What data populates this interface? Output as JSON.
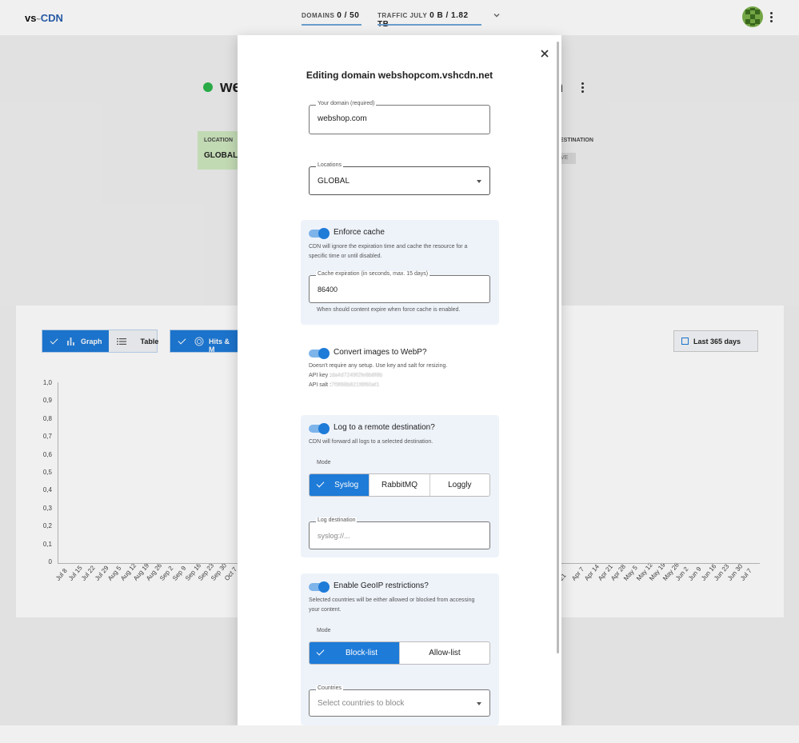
{
  "header": {
    "logo_prefix": "vs",
    "logo_sep": "~",
    "logo_suffix": "CDN",
    "domains_label": "DOMAINS",
    "domains_value": "0 / 50",
    "traffic_label": "TRAFFIC JULY",
    "traffic_value": "0 B / 1.82 TB"
  },
  "page": {
    "title_partial_left": "we",
    "title_partial_right": "n",
    "location_label": "LOCATION",
    "location_value": "GLOBAL",
    "destination_label": "ESTINATION",
    "destination_chip": "VE"
  },
  "chart_toolbar": {
    "graph_label": "Graph",
    "table_label": "Table",
    "metric_label": "Hits & M",
    "range_label": "Last 365 days"
  },
  "chart_data": {
    "type": "line",
    "y_ticks": [
      "1,0",
      "0,9",
      "0,8",
      "0,7",
      "0,6",
      "0,5",
      "0,4",
      "0,3",
      "0,2",
      "0,1",
      "0"
    ],
    "x_ticks_left": [
      "Jul 8",
      "Jul 15",
      "Jul 22",
      "Jul 29",
      "Aug 5",
      "Aug 12",
      "Aug 19",
      "Aug 26",
      "Sep 2",
      "Sep 9",
      "Sep 16",
      "Sep 23",
      "Sep 30",
      "Oct 7"
    ],
    "x_ticks_right": [
      "21",
      "Apr 7",
      "Apr 14",
      "Apr 21",
      "Apr 28",
      "May 5",
      "May 12",
      "May 19",
      "May 26",
      "Jun 2",
      "Jun 9",
      "Jun 16",
      "Jun 23",
      "Jun 30",
      "Jul 7"
    ],
    "ylim": [
      0,
      1.0
    ],
    "series": []
  },
  "modal": {
    "title": "Editing domain webshopcom.vshcdn.net",
    "domain_legend": "Your domain (required)",
    "domain_value": "webshop.com",
    "locations_legend": "Locations",
    "locations_value": "GLOBAL",
    "enforce_cache": {
      "label": "Enforce cache",
      "desc": "CDN will ignore the expiration time and cache the resource for a specific time or until disabled.",
      "expiry_legend": "Cache expiration (in seconds, max. 15 days)",
      "expiry_value": "86400",
      "hint": "When should content expire when force cache is enabled."
    },
    "webp": {
      "label": "Convert images to WebP?",
      "desc": "Doesn't require any setup. Use key and salt for resizing.",
      "api_key_label": "API key :",
      "api_key_value": "da4d7249f2fe8b8f8b",
      "api_salt_label": "API salt :",
      "api_salt_value": "7f9f88b821f8f60af1"
    },
    "logging": {
      "label": "Log to a remote destination?",
      "desc": "CDN will forward all logs to a selected destination.",
      "mode_label": "Mode",
      "options": [
        "Syslog",
        "RabbitMQ",
        "Loggly"
      ],
      "dest_legend": "Log destination",
      "dest_placeholder": "syslog://..."
    },
    "geoip": {
      "label": "Enable GeoIP restrictions?",
      "desc": "Selected countries will be either allowed or blocked from accessing your content.",
      "mode_label": "Mode",
      "options": [
        "Block-list",
        "Allow-list"
      ],
      "countries_legend": "Countries",
      "countries_placeholder": "Select countries to block"
    }
  },
  "colors": {
    "accent": "#1e7bd8",
    "status_green": "#2db54b"
  }
}
